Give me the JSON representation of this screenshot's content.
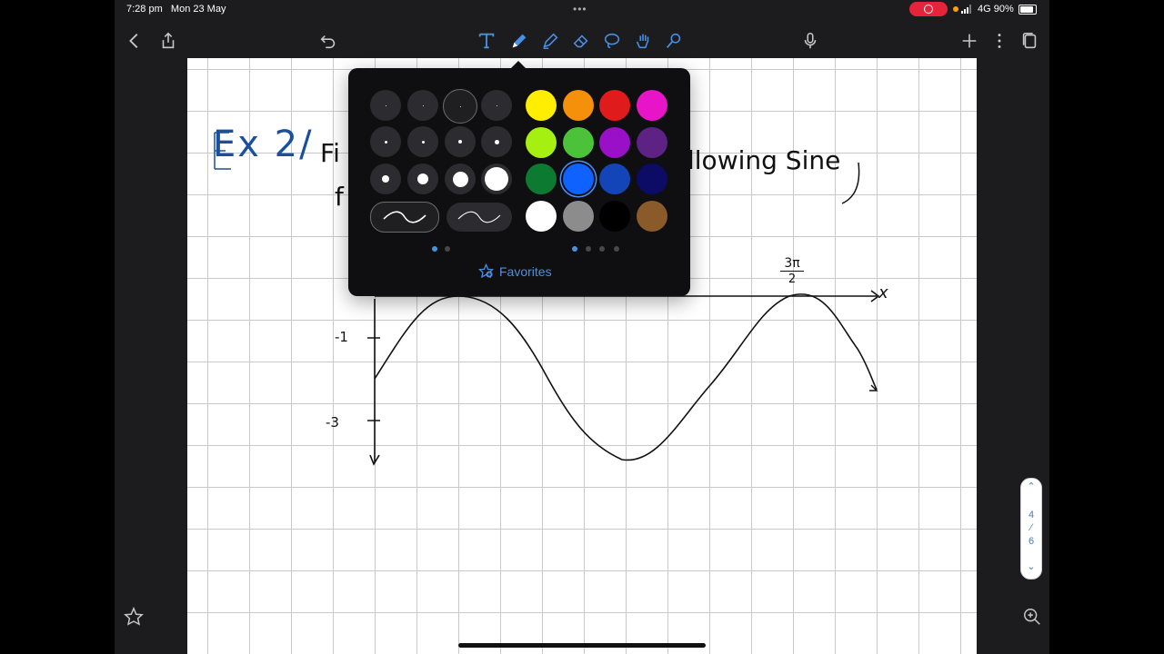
{
  "status_bar": {
    "time": "7:28 pm",
    "date": "Mon 23 May",
    "network": "4G",
    "battery": "90%"
  },
  "toolbar": {
    "left_icons": [
      "back-icon",
      "share-icon"
    ],
    "undo_icon": "undo-icon",
    "tools": [
      "text-tool-icon",
      "pen-tool-icon",
      "highlighter-icon",
      "eraser-icon",
      "lasso-icon",
      "hand-icon",
      "laser-pointer-icon"
    ],
    "active_tool": "pen-tool-icon",
    "right_icons": [
      "microphone-icon",
      "add-icon",
      "more-icon",
      "pages-icon"
    ]
  },
  "pen_popover": {
    "colors": [
      "#ffee00",
      "#f5900b",
      "#e01b1b",
      "#e814c8",
      "#a6f011",
      "#4cc23b",
      "#9a10c8",
      "#5e2184",
      "#0d7a32",
      "#0f62fe",
      "#1445b8",
      "#0c0c66",
      "#ffffff",
      "#8c8c8c",
      "#000000",
      "#8a5a2b"
    ],
    "selected_color": "#0f62fe",
    "favorites_label": "Favorites"
  },
  "page_indicator": {
    "current": "4",
    "total": "6"
  },
  "notes": {
    "heading": "Ex 2/",
    "line1_start": "Fi",
    "line1_end": "llowing Sine",
    "line2": "f",
    "y_tick_1": "-1",
    "y_tick_2": "-3",
    "x_label_num": "3π",
    "x_label_den": "2",
    "x_axis": "x"
  }
}
